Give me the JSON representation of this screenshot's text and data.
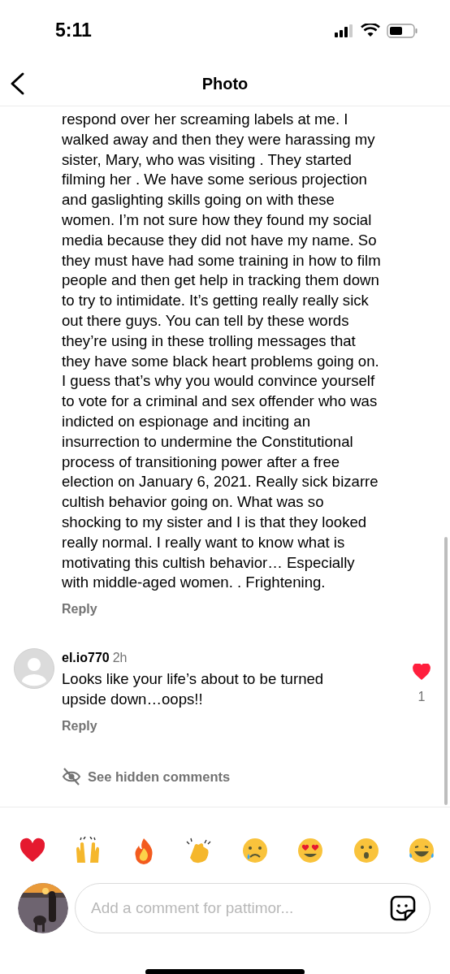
{
  "status_bar": {
    "time": "5:11"
  },
  "header": {
    "title": "Photo"
  },
  "comments": [
    {
      "text": "respond over her screaming labels at me. I walked away and then they were harassing my sister, Mary, who was visiting . They started filming her . We have some serious projection and gaslighting skills going on with these women. I’m not sure how they found my social media because they did not have my name. So they must have had some training in how to film people and then get help in tracking them down to try to intimidate. It’s getting really really sick out there guys. You can tell by these words they’re using in these trolling messages that they have some black heart problems going on. I guess that’s why you would convince yourself to vote for a criminal and sex offender who was indicted on espionage and inciting an insurrection to undermine the Constitutional process of transitioning power after a free election on January 6, 2021. Really sick bizarre cultish behavior going on. What was so shocking to my sister and I is that they looked really normal.  I really want to know what is motivating this cultish behavior… Especially with middle-aged women. .  Frightening.",
      "reply": "Reply"
    },
    {
      "username": "el.io770",
      "time": "2h",
      "text": "Looks like your life’s about to be turned upside down…oops!!",
      "reply": "Reply",
      "liked": true,
      "likes": "1"
    }
  ],
  "hidden_comments": "See hidden comments",
  "reactions": [
    {
      "kind": "heart"
    },
    {
      "kind": "raised-hands"
    },
    {
      "kind": "fire"
    },
    {
      "kind": "clap"
    },
    {
      "kind": "crying"
    },
    {
      "kind": "heart-eyes"
    },
    {
      "kind": "surprised"
    },
    {
      "kind": "laughing"
    }
  ],
  "composer": {
    "placeholder": "Add a comment for pattimor..."
  }
}
